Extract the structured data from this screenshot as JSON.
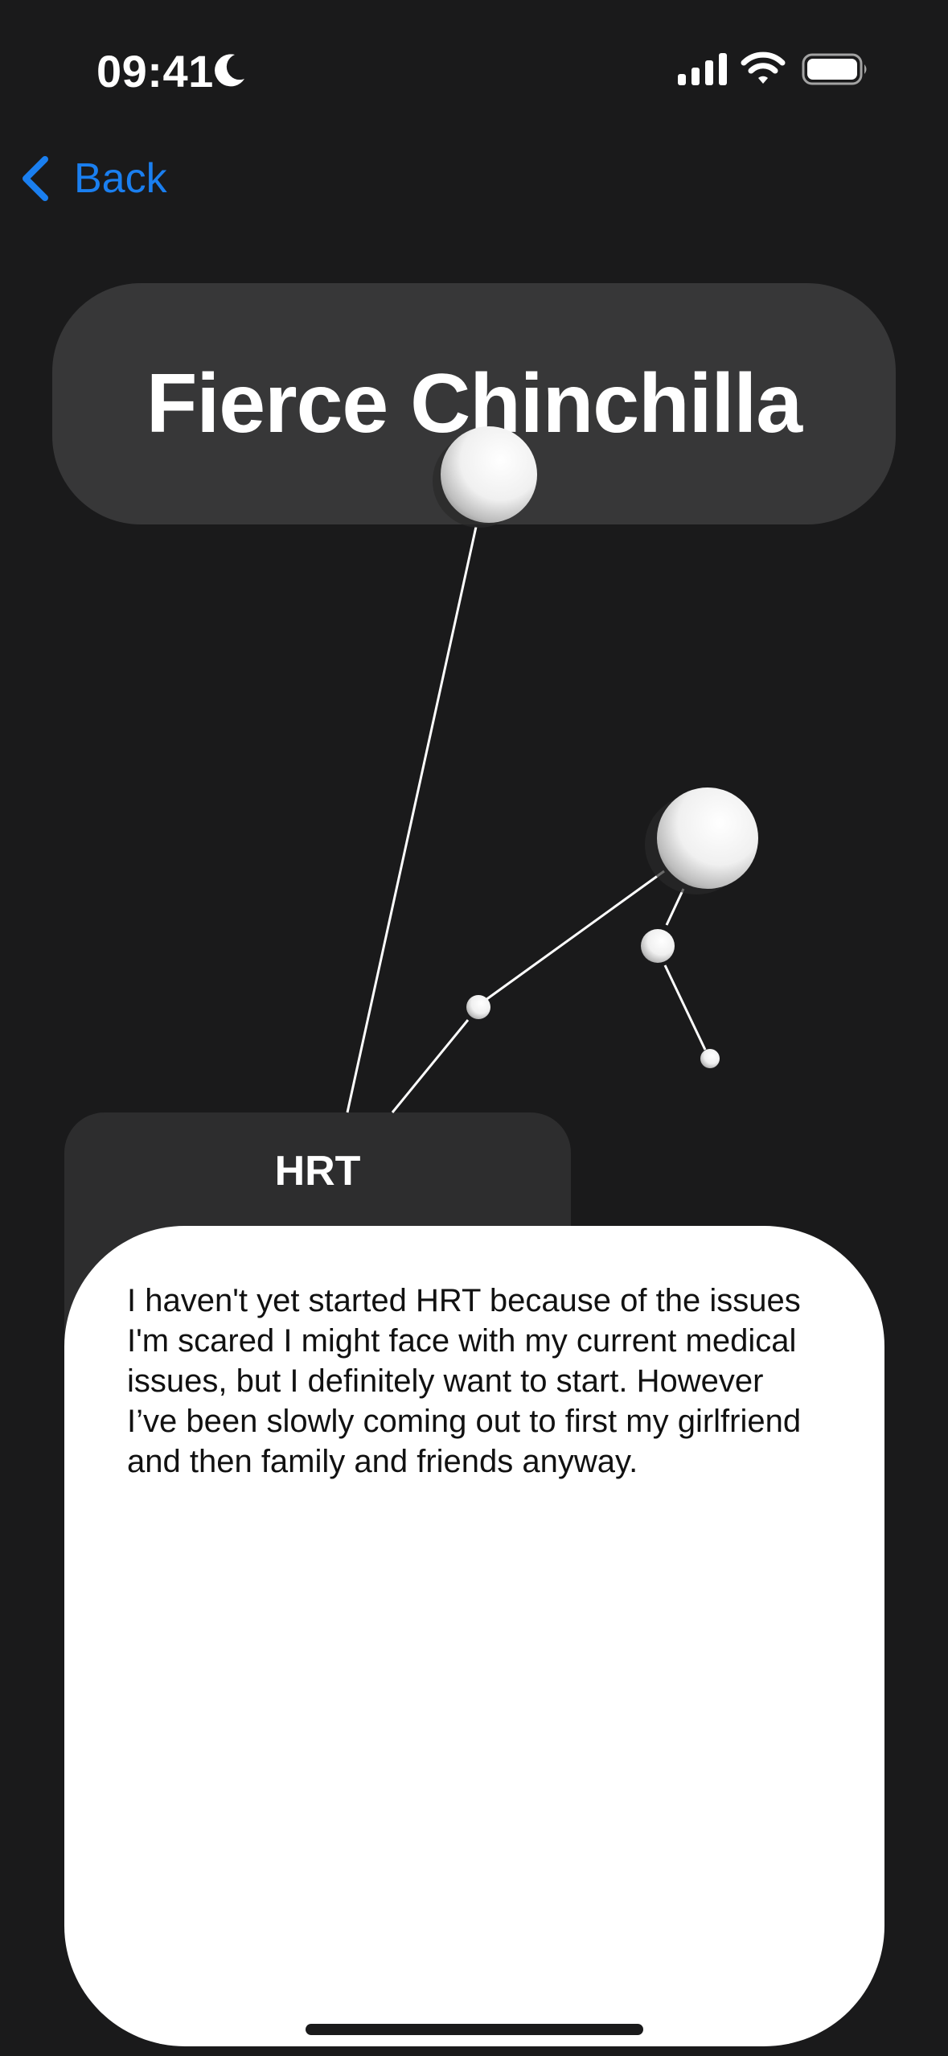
{
  "status_bar": {
    "time": "09:41",
    "icons": [
      "moon-icon",
      "signal-icon",
      "wifi-icon",
      "battery-icon"
    ]
  },
  "nav": {
    "back_label": "Back",
    "accent_color": "#1a7ff0"
  },
  "header": {
    "title": "Fierce Chinchilla"
  },
  "topic": {
    "title": "HRT"
  },
  "story": {
    "text": "I haven't yet started HRT because of the issues I'm scared I might face with my current medical issues, but I definitely want to start. However I’ve been slowly coming out to first my girlfriend and then family and friends anyway."
  },
  "colors": {
    "background": "#1a1a1b",
    "title_card": "#373738",
    "topic_card": "#2d2d2e",
    "sheet": "#ffffff"
  }
}
